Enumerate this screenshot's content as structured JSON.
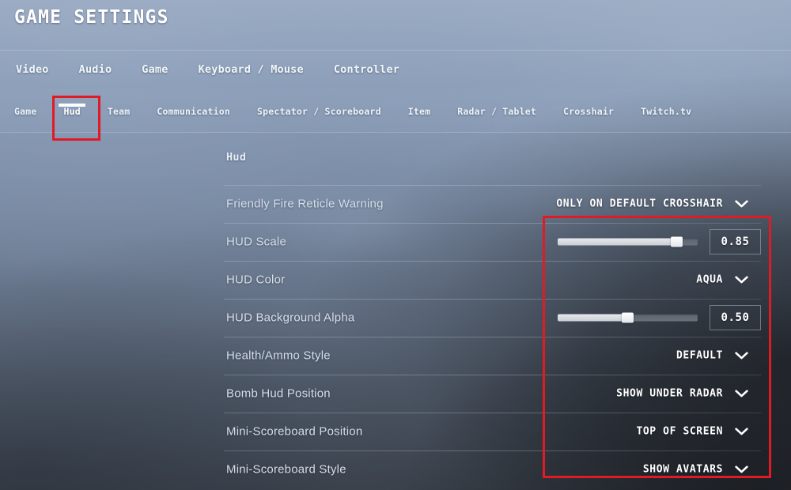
{
  "header": {
    "title": "GAME SETTINGS"
  },
  "primary_nav": {
    "items": [
      {
        "label": "Video"
      },
      {
        "label": "Audio"
      },
      {
        "label": "Game"
      },
      {
        "label": "Keyboard / Mouse"
      },
      {
        "label": "Controller"
      }
    ]
  },
  "secondary_nav": {
    "active": "Hud",
    "items": [
      {
        "label": "Game"
      },
      {
        "label": "Hud"
      },
      {
        "label": "Team"
      },
      {
        "label": "Communication"
      },
      {
        "label": "Spectator / Scoreboard"
      },
      {
        "label": "Item"
      },
      {
        "label": "Radar / Tablet"
      },
      {
        "label": "Crosshair"
      },
      {
        "label": "Twitch.tv"
      }
    ]
  },
  "section": {
    "heading": "Hud"
  },
  "settings": [
    {
      "label": "Friendly Fire Reticle Warning",
      "type": "dropdown",
      "value": "ONLY ON DEFAULT CROSSHAIR"
    },
    {
      "label": "HUD Scale",
      "type": "slider",
      "value": "0.85",
      "fraction": 0.85
    },
    {
      "label": "HUD Color",
      "type": "dropdown",
      "value": "AQUA"
    },
    {
      "label": "HUD Background Alpha",
      "type": "slider",
      "value": "0.50",
      "fraction": 0.5
    },
    {
      "label": "Health/Ammo Style",
      "type": "dropdown",
      "value": "DEFAULT"
    },
    {
      "label": "Bomb Hud Position",
      "type": "dropdown",
      "value": "SHOW UNDER RADAR"
    },
    {
      "label": "Mini-Scoreboard Position",
      "type": "dropdown",
      "value": "TOP OF SCREEN"
    },
    {
      "label": "Mini-Scoreboard Style",
      "type": "dropdown",
      "value": "SHOW AVATARS"
    }
  ],
  "annotations": {
    "color": "#e01b24",
    "boxes": [
      {
        "name": "hud-tab-highlight"
      },
      {
        "name": "hud-controls-highlight"
      }
    ]
  }
}
